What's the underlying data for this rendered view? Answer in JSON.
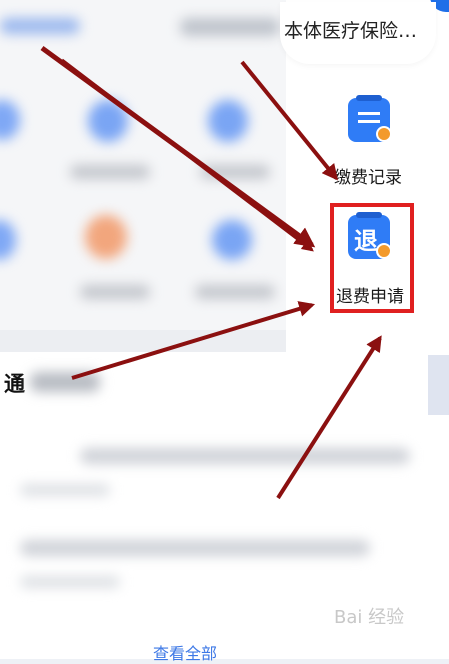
{
  "top_card": {
    "title": "本体医疗保险…"
  },
  "side_menu": {
    "items": [
      {
        "label": "缴费记录",
        "icon": "payment-record-icon"
      },
      {
        "label": "退费申请",
        "icon": "refund-application-icon",
        "glyph": "退",
        "highlighted": true
      }
    ]
  },
  "notice": {
    "title_char": "通"
  },
  "footer": {
    "view_all": "查看全部"
  },
  "watermark": {
    "text": "Bai 经验"
  },
  "colors": {
    "accent": "#2f7cf6",
    "highlight": "#e02020",
    "arrow": "#8b1010",
    "link": "#3d78e6"
  }
}
